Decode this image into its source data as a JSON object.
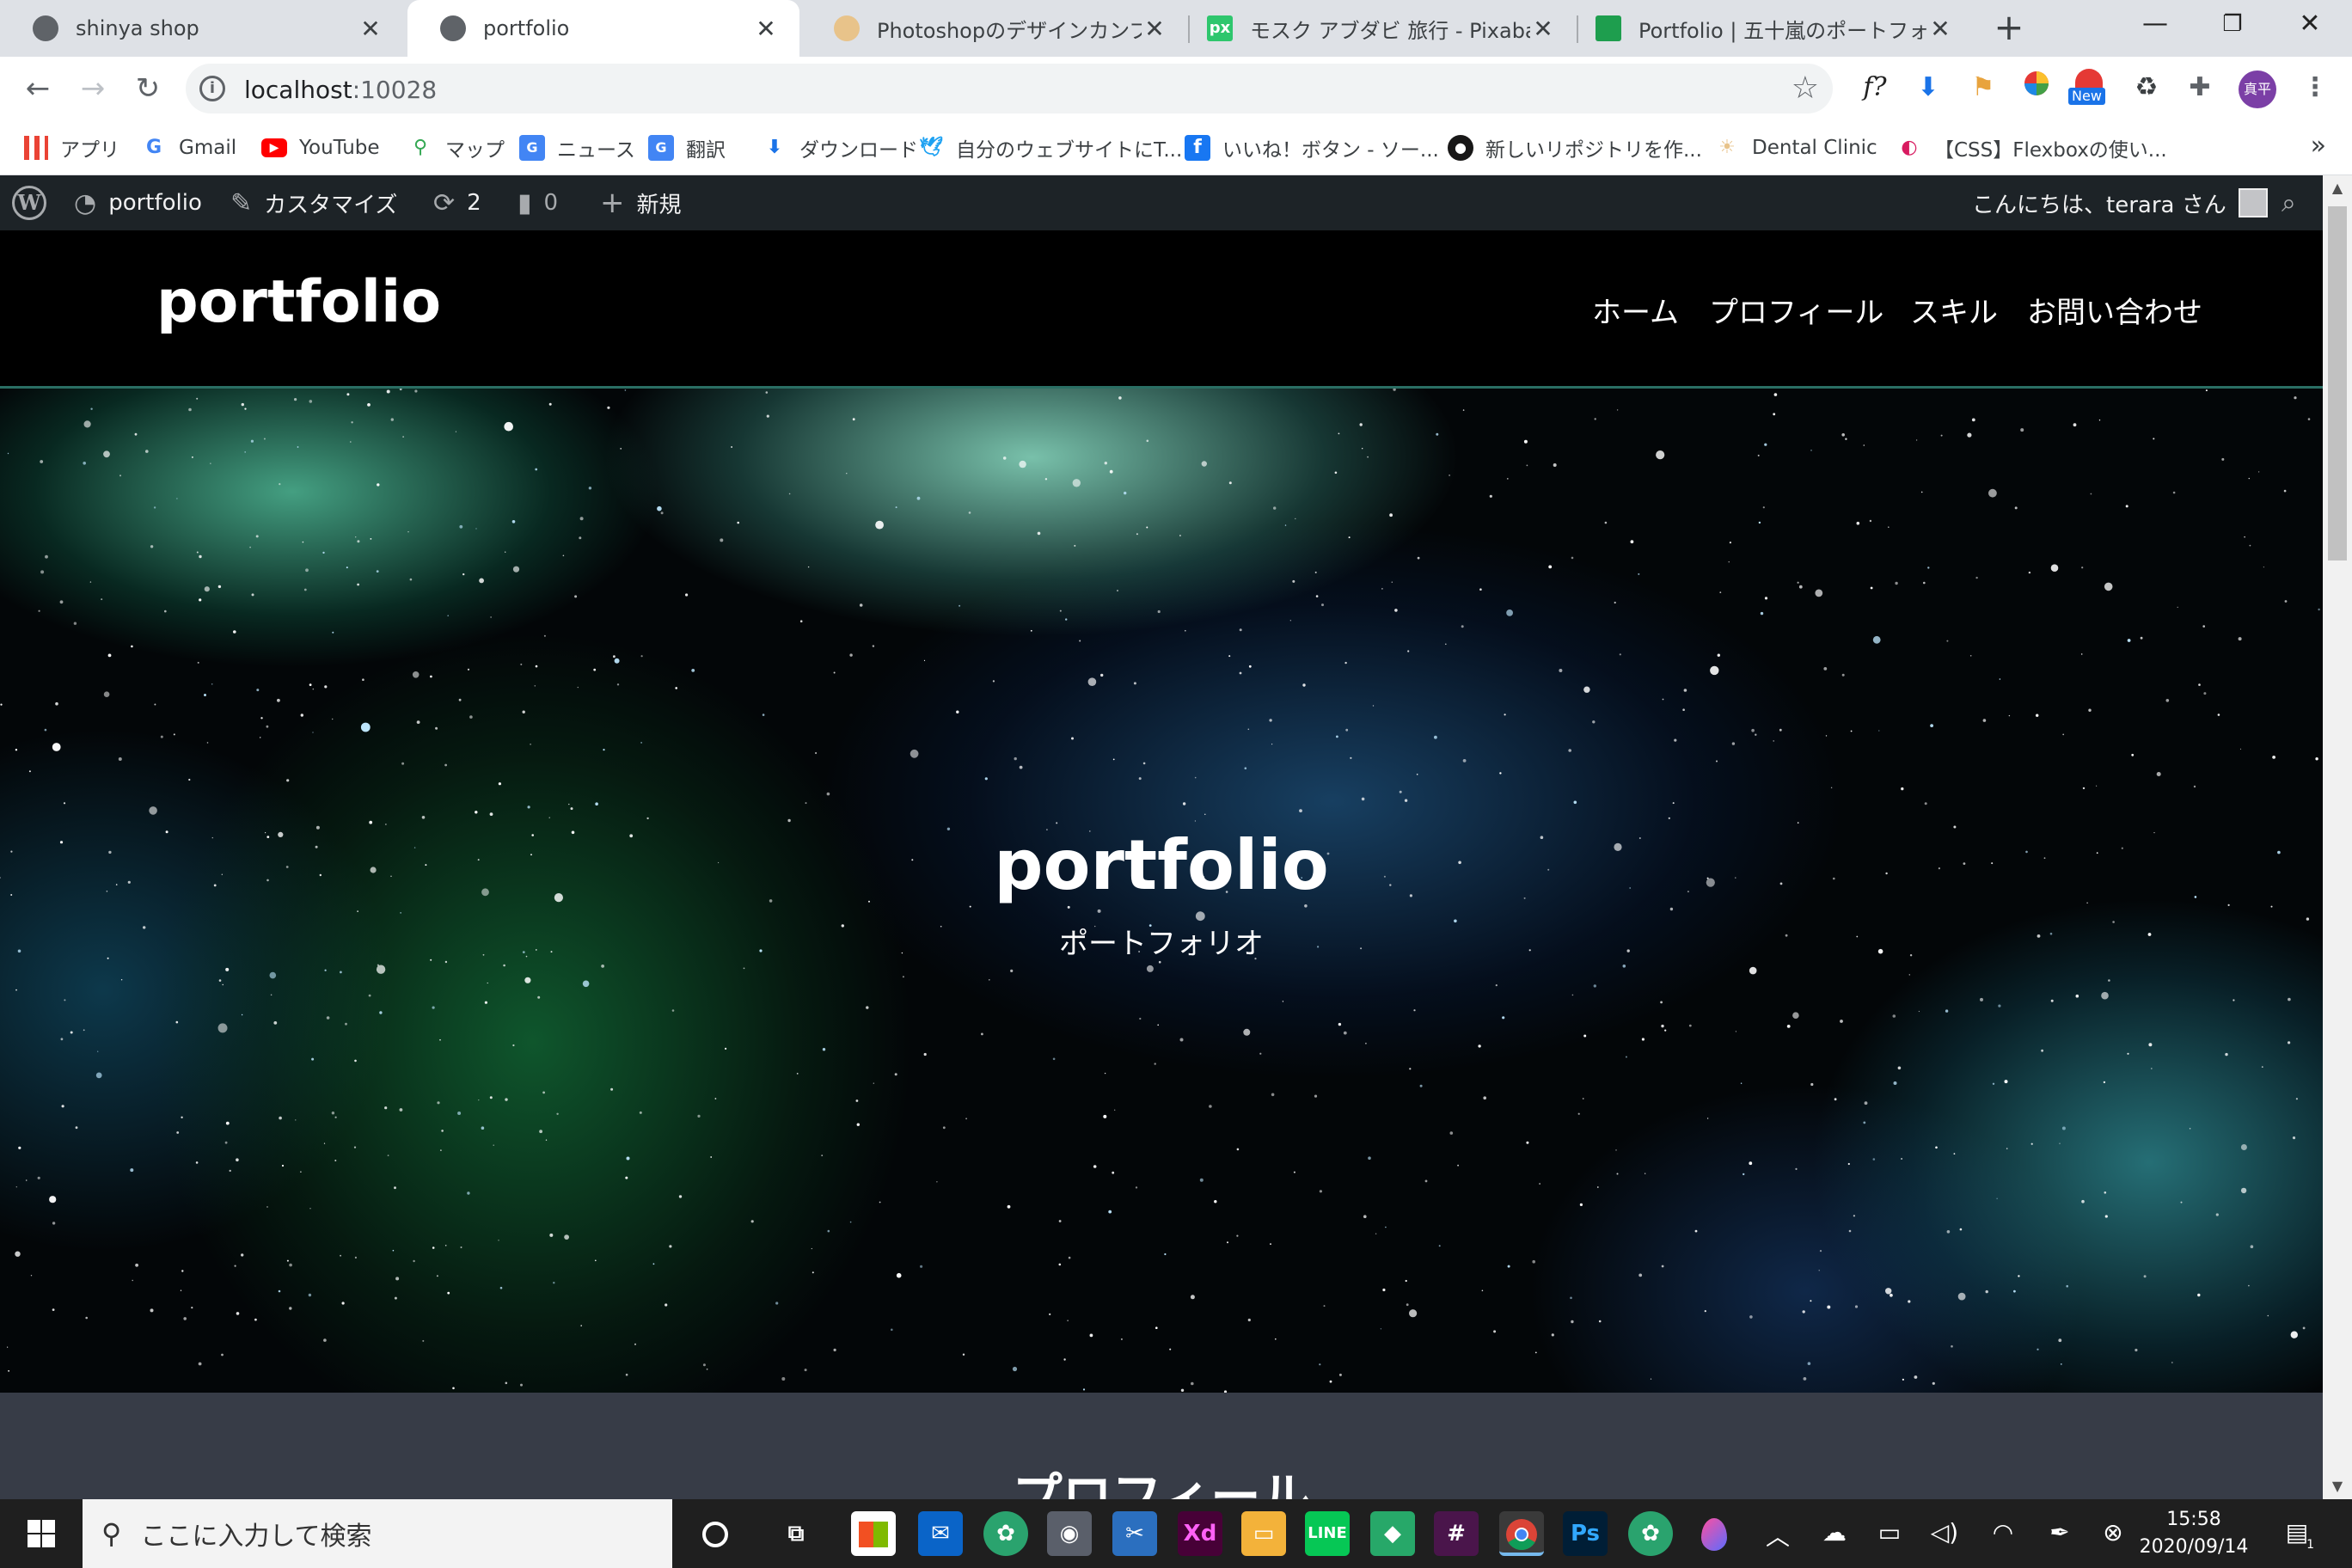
{
  "browser": {
    "tabs": [
      {
        "title": "shinya shop",
        "active": false
      },
      {
        "title": "portfolio",
        "active": true
      },
      {
        "title": "Photoshopのデザインカンプからコ",
        "active": false
      },
      {
        "title": "モスク アブダビ 旅行 - Pixabayの無",
        "active": false
      },
      {
        "title": "Portfolio | 五十嵐のポートフォリオ",
        "active": false
      }
    ],
    "new_tab": "+",
    "url_host": "localhost",
    "url_port": ":10028",
    "extensions": [
      "f?",
      "New",
      "真平"
    ],
    "bookmarks": [
      {
        "label": "アプリ",
        "icon": "apps-grid-icon"
      },
      {
        "label": "Gmail",
        "icon": "google-icon"
      },
      {
        "label": "YouTube",
        "icon": "youtube-icon"
      },
      {
        "label": "マップ",
        "icon": "maps-icon"
      },
      {
        "label": "ニュース",
        "icon": "news-icon"
      },
      {
        "label": "翻訳",
        "icon": "translate-icon"
      },
      {
        "label": "ダウンロード",
        "icon": "download-icon"
      },
      {
        "label": "自分のウェブサイトにT...",
        "icon": "twitter-icon"
      },
      {
        "label": "いいね！ボタン - ソー...",
        "icon": "facebook-icon"
      },
      {
        "label": "新しいリポジトリを作...",
        "icon": "github-icon"
      },
      {
        "label": "Dental Clinic",
        "icon": "dental-icon"
      },
      {
        "label": "【CSS】Flexboxの使い...",
        "icon": "css-icon"
      }
    ]
  },
  "admin_bar": {
    "site_name": "portfolio",
    "customize": "カスタマイズ",
    "updates_count": "2",
    "comments_count": "0",
    "new_label": "新規",
    "greeting": "こんにちは、terara さん"
  },
  "site": {
    "title": "portfolio",
    "nav": [
      "ホーム",
      "プロフィール",
      "スキル",
      "お問い合わせ"
    ]
  },
  "hero": {
    "title": "portfolio",
    "subtitle": "ポートフォリオ"
  },
  "section": {
    "title": "プロフィール"
  },
  "taskbar": {
    "search_placeholder": "ここに入力して検索",
    "time": "15:58",
    "date": "2020/09/14",
    "notification_count": "1"
  }
}
